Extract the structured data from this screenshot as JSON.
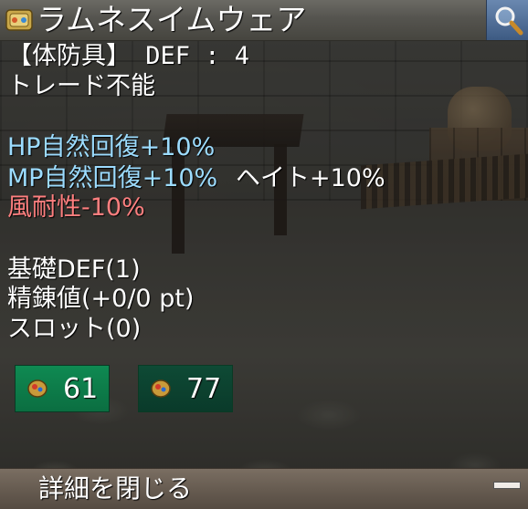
{
  "item": {
    "name": "ラムネスイムウェア",
    "type_line": "【体防具】 DEF : 4",
    "trade": "トレード不能"
  },
  "effects": {
    "hp_regen": "HP自然回復+10%",
    "mp_regen": "MP自然回復+10%",
    "hate": "ヘイト+10%",
    "wind_resist": "風耐性-10%"
  },
  "stats": {
    "base_def": "基礎DEF(1)",
    "refine": "精錬値(+0/0 pt)",
    "slot": "スロット(0)"
  },
  "costs": [
    {
      "value": "61",
      "icon": "coin-icon"
    },
    {
      "value": "77",
      "icon": "coin-icon"
    }
  ],
  "footer": {
    "close_label": "詳細を閉じる"
  },
  "colors": {
    "cyan_text": "#9cdcff",
    "red_text": "#ff7f7f",
    "cost_green": "#0f8a52",
    "cost_dark_green": "#0e4a35"
  },
  "icons": {
    "item": "swimwear-item-icon",
    "search": "magnifier-icon",
    "collapse": "minus-icon"
  }
}
